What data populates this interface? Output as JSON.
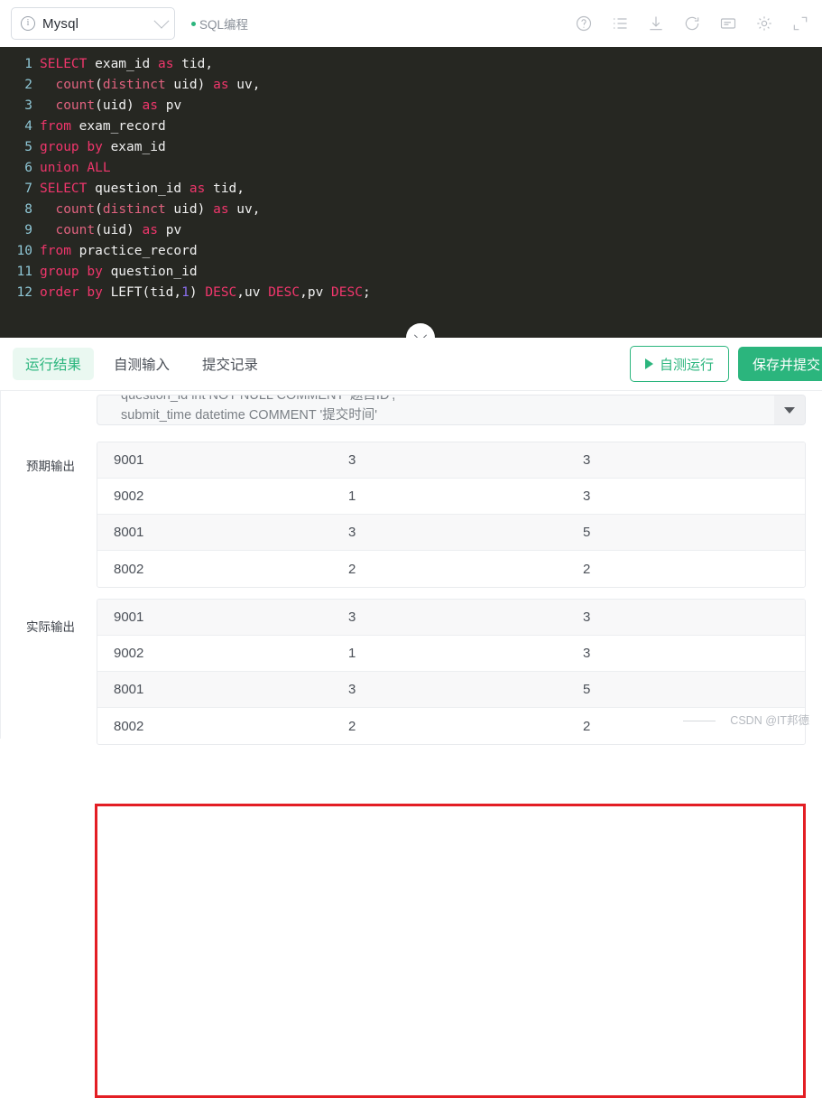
{
  "header": {
    "db_select": {
      "value": "Mysql",
      "info_icon": "info-circle-icon",
      "chevron": "chevron-down-icon"
    },
    "mode_label": "SQL编程",
    "toolbar_icons": [
      {
        "name": "help-icon",
        "title": "帮助"
      },
      {
        "name": "list-icon",
        "title": "列表"
      },
      {
        "name": "download-icon",
        "title": "下载"
      },
      {
        "name": "refresh-icon",
        "title": "重置"
      },
      {
        "name": "note-icon",
        "title": "笔记"
      },
      {
        "name": "gear-icon",
        "title": "设置"
      },
      {
        "name": "fullscreen-icon",
        "title": "全屏"
      }
    ]
  },
  "editor": {
    "lines": [
      {
        "no": "1",
        "tokens": [
          {
            "t": "kw",
            "v": "SELECT"
          },
          {
            "t": "id",
            "v": " exam_id "
          },
          {
            "t": "kw",
            "v": "as"
          },
          {
            "t": "id",
            "v": " tid,"
          }
        ]
      },
      {
        "no": "2",
        "tokens": [
          {
            "t": "id",
            "v": "  "
          },
          {
            "t": "fn",
            "v": "count"
          },
          {
            "t": "punc",
            "v": "("
          },
          {
            "t": "fn",
            "v": "distinct"
          },
          {
            "t": "id",
            "v": " uid) "
          },
          {
            "t": "kw",
            "v": "as"
          },
          {
            "t": "id",
            "v": " uv,"
          }
        ]
      },
      {
        "no": "3",
        "tokens": [
          {
            "t": "id",
            "v": "  "
          },
          {
            "t": "fn",
            "v": "count"
          },
          {
            "t": "punc",
            "v": "("
          },
          {
            "t": "id",
            "v": "uid) "
          },
          {
            "t": "kw",
            "v": "as"
          },
          {
            "t": "id",
            "v": " pv"
          }
        ]
      },
      {
        "no": "4",
        "tokens": [
          {
            "t": "kw",
            "v": "from"
          },
          {
            "t": "id",
            "v": " exam_record"
          }
        ]
      },
      {
        "no": "5",
        "tokens": [
          {
            "t": "kw",
            "v": "group by"
          },
          {
            "t": "id",
            "v": " exam_id"
          }
        ]
      },
      {
        "no": "6",
        "tokens": [
          {
            "t": "kw",
            "v": "union ALL"
          }
        ]
      },
      {
        "no": "7",
        "tokens": [
          {
            "t": "kw",
            "v": "SELECT"
          },
          {
            "t": "id",
            "v": " question_id "
          },
          {
            "t": "kw",
            "v": "as"
          },
          {
            "t": "id",
            "v": " tid,"
          }
        ]
      },
      {
        "no": "8",
        "tokens": [
          {
            "t": "id",
            "v": "  "
          },
          {
            "t": "fn",
            "v": "count"
          },
          {
            "t": "punc",
            "v": "("
          },
          {
            "t": "fn",
            "v": "distinct"
          },
          {
            "t": "id",
            "v": " uid) "
          },
          {
            "t": "kw",
            "v": "as"
          },
          {
            "t": "id",
            "v": " uv,"
          }
        ]
      },
      {
        "no": "9",
        "tokens": [
          {
            "t": "id",
            "v": "  "
          },
          {
            "t": "fn",
            "v": "count"
          },
          {
            "t": "punc",
            "v": "("
          },
          {
            "t": "id",
            "v": "uid) "
          },
          {
            "t": "kw",
            "v": "as"
          },
          {
            "t": "id",
            "v": " pv"
          }
        ]
      },
      {
        "no": "10",
        "tokens": [
          {
            "t": "kw",
            "v": "from"
          },
          {
            "t": "id",
            "v": " practice_record"
          }
        ]
      },
      {
        "no": "11",
        "tokens": [
          {
            "t": "kw",
            "v": "group by"
          },
          {
            "t": "id",
            "v": " question_id"
          }
        ]
      },
      {
        "no": "12",
        "tokens": [
          {
            "t": "kw",
            "v": "order by"
          },
          {
            "t": "id",
            "v": " LEFT(tid,"
          },
          {
            "t": "num",
            "v": "1"
          },
          {
            "t": "id",
            "v": ") "
          },
          {
            "t": "kw",
            "v": "DESC"
          },
          {
            "t": "id",
            "v": ",uv "
          },
          {
            "t": "kw",
            "v": "DESC"
          },
          {
            "t": "id",
            "v": ",pv "
          },
          {
            "t": "kw",
            "v": "DESC"
          },
          {
            "t": "id",
            "v": ";"
          }
        ]
      }
    ],
    "collapse_icon": "chevron-down-icon"
  },
  "tabs": [
    {
      "label": "运行结果",
      "active": true
    },
    {
      "label": "自测输入",
      "active": false
    },
    {
      "label": "提交记录",
      "active": false
    }
  ],
  "actions": {
    "run_label": "自测运行",
    "submit_label": "保存并提交"
  },
  "schema": {
    "line1": "question_id int NOT NULL COMMENT '题目ID',",
    "line2": "submit_time datetime COMMENT '提交时间'",
    "expand_icon": "triangle-down-icon"
  },
  "results": {
    "expected_label": "预期输出",
    "actual_label": "实际输出",
    "expected_rows": [
      [
        "9001",
        "3",
        "3"
      ],
      [
        "9002",
        "1",
        "3"
      ],
      [
        "8001",
        "3",
        "5"
      ],
      [
        "8002",
        "2",
        "2"
      ]
    ],
    "actual_rows": [
      [
        "9001",
        "3",
        "3"
      ],
      [
        "9002",
        "1",
        "3"
      ],
      [
        "8001",
        "3",
        "5"
      ],
      [
        "8002",
        "2",
        "2"
      ]
    ]
  },
  "watermark": "CSDN @IT邦德",
  "colors": {
    "accent_green": "#2bb57d",
    "highlight_red": "#e31e24",
    "editor_bg": "#262722",
    "keyword": "#f0366c",
    "function": "#e0627f",
    "number": "#8b6ef0",
    "linenumber": "#8fc7d6"
  }
}
